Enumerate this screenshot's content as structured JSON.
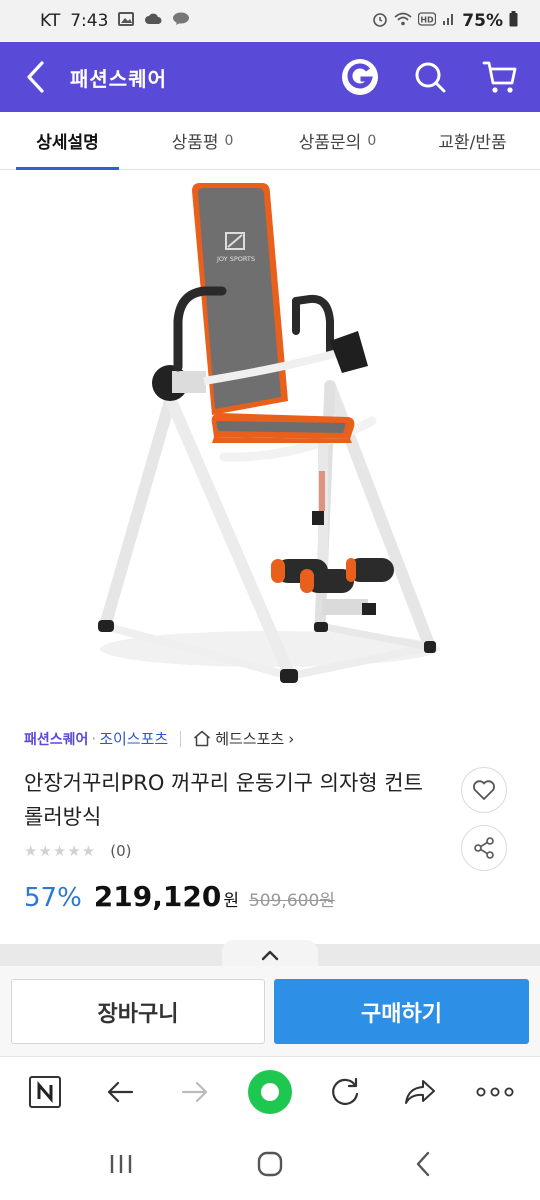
{
  "status_bar": {
    "carrier": "KT",
    "time": "7:43",
    "battery": "75%",
    "icons": [
      "image-icon",
      "cloud-icon",
      "talk-icon",
      "alarm-icon",
      "wifi-icon",
      "hd-icon",
      "signal-icon",
      "battery-icon"
    ]
  },
  "header": {
    "title": "패션스퀘어",
    "icons": [
      "back-arrow-icon",
      "g-logo-icon",
      "search-icon",
      "cart-icon"
    ]
  },
  "tabs": [
    {
      "label": "상세설명",
      "count": ""
    },
    {
      "label": "상품평",
      "count": "0"
    },
    {
      "label": "상품문의",
      "count": "0"
    },
    {
      "label": "교환/반품",
      "count": ""
    }
  ],
  "product_image": {
    "logo_text": "JOY SPORTS",
    "accent": "#e8601c",
    "frame": "#f2f2f2",
    "seat": "#6b6b6b"
  },
  "breadcrumb": {
    "store": "패션스퀘어",
    "separator": "·",
    "brand": "조이스포츠",
    "category": "헤드스포츠",
    "chevron": "›"
  },
  "product": {
    "name": "안장거꾸리PRO 꺼꾸리 운동기구 의자형 컨트롤러방식",
    "stars": "★★★★★",
    "review_count": "(0)",
    "discount": "57%",
    "price": "219,120",
    "currency": "원",
    "original_price": "509,600원"
  },
  "actions": {
    "cart": "장바구니",
    "buy": "구매하기"
  },
  "browser_bar": {
    "icons": [
      "naver-n-icon",
      "back-icon",
      "forward-icon",
      "green-home-icon",
      "refresh-icon",
      "share-arrow-icon",
      "more-icon"
    ]
  },
  "system_nav": {
    "icons": [
      "recent-apps-icon",
      "home-icon",
      "back-nav-icon"
    ]
  },
  "colors": {
    "brand": "#5a4ad8",
    "tab_indicator": "#2c64c8",
    "discount": "#2c78d4",
    "buy_button": "#2d8fe6"
  }
}
